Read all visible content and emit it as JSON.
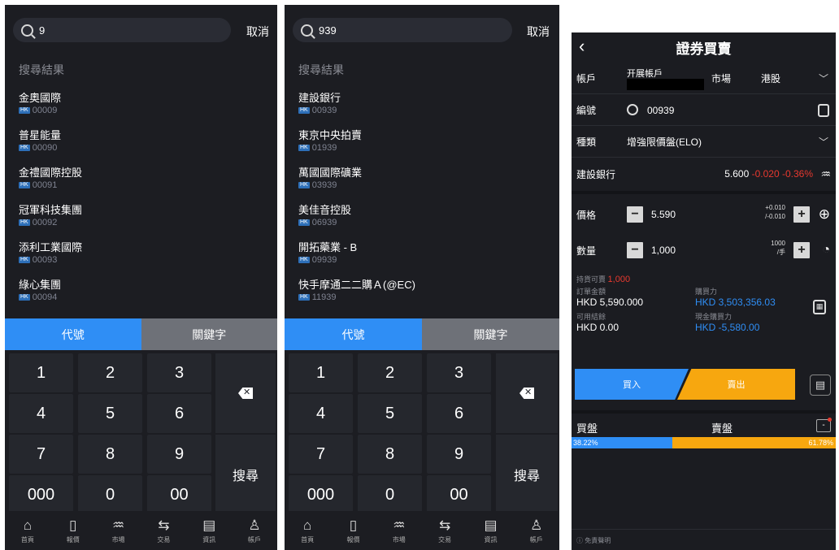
{
  "panel1": {
    "search_value": "9",
    "cancel": "取消",
    "results_header": "搜尋結果",
    "market_badge": "HK",
    "results": [
      {
        "name": "金奧國際",
        "code": "00009"
      },
      {
        "name": "普星能量",
        "code": "00090"
      },
      {
        "name": "金禮國際控股",
        "code": "00091"
      },
      {
        "name": "冠軍科技集團",
        "code": "00092"
      },
      {
        "name": "添利工業國際",
        "code": "00093"
      },
      {
        "name": "綠心集團",
        "code": "00094"
      }
    ],
    "tab_code": "代號",
    "tab_keyword": "關鍵字"
  },
  "panel2": {
    "search_value": "939",
    "cancel": "取消",
    "results_header": "搜尋結果",
    "market_badge": "HK",
    "results": [
      {
        "name": "建設銀行",
        "code": "00939"
      },
      {
        "name": "東京中央拍賣",
        "code": "01939"
      },
      {
        "name": "萬國國際礦業",
        "code": "03939"
      },
      {
        "name": "美佳音控股",
        "code": "06939"
      },
      {
        "name": "開拓藥業 - B",
        "code": "09939"
      },
      {
        "name": "快手摩通二二購Ａ(@EC)",
        "code": "11939"
      }
    ],
    "tab_code": "代號",
    "tab_keyword": "關鍵字"
  },
  "keypad": {
    "k1": "1",
    "k2": "2",
    "k3": "3",
    "k4": "4",
    "k5": "5",
    "k6": "6",
    "k7": "7",
    "k8": "8",
    "k9": "9",
    "k000": "000",
    "k0": "0",
    "k00": "00",
    "search": "搜尋"
  },
  "nav": {
    "home": "首頁",
    "quotes": "報價",
    "market": "市場",
    "trade": "交易",
    "news": "資訊",
    "account": "帳戶"
  },
  "trade": {
    "title": "證券買賣",
    "account_label": "帳戶",
    "account_value": "开展帳戶",
    "market_label": "市場",
    "market_value": "港股",
    "code_label": "編號",
    "code_value": "00939",
    "type_label": "種類",
    "type_value": "增強限價盤(ELO)",
    "stock_name": "建設銀行",
    "stock_price": "5.600",
    "stock_change": "-0.020",
    "stock_pct": "-0.36%",
    "price_label": "價格",
    "price_value": "5.590",
    "price_step_up": "+0.010",
    "price_step_down": "/-0.010",
    "qty_label": "數量",
    "qty_value": "1,000",
    "qty_step": "1000",
    "qty_unit": "/手",
    "sellable_label": "持貨可賣",
    "sellable_value": "1,000",
    "order_amount_label": "訂單金額",
    "order_amount_value": "HKD 5,590.000",
    "buying_power_label": "購買力",
    "buying_power_value": "HKD 3,503,356.03",
    "cash_label": "可用結餘",
    "cash_value": "HKD 0.00",
    "cash_bp_label": "現金購買力",
    "cash_bp_value": "HKD -5,580.00",
    "buy": "買入",
    "sell": "賣出",
    "bid_label": "買盤",
    "ask_label": "賣盤",
    "bid_pct": "38.22%",
    "ask_pct": "61.78%",
    "disclaimer": "免責聲明"
  }
}
